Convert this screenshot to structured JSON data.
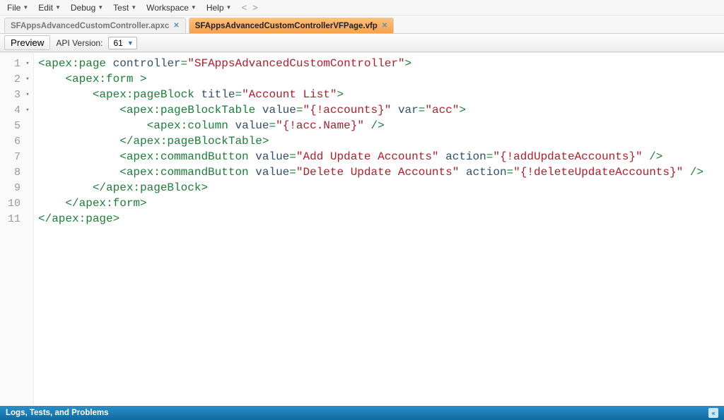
{
  "menu": {
    "items": [
      "File",
      "Edit",
      "Debug",
      "Test",
      "Workspace",
      "Help"
    ],
    "nav_back": "<",
    "nav_fwd": ">"
  },
  "tabs": [
    {
      "label": "SFAppsAdvancedCustomController.apxc",
      "active": false
    },
    {
      "label": "SFAppsAdvancedCustomControllerVFPage.vfp",
      "active": true
    }
  ],
  "subtoolbar": {
    "preview_label": "Preview",
    "api_label": "API Version:",
    "api_value": "61"
  },
  "code": {
    "lines": [
      {
        "num": 1,
        "fold": true,
        "indent": "",
        "tokens": [
          {
            "t": "pun",
            "v": "<"
          },
          {
            "t": "tag",
            "v": "apex:page"
          },
          {
            "t": "txt",
            "v": " "
          },
          {
            "t": "an",
            "v": "controller"
          },
          {
            "t": "pun",
            "v": "="
          },
          {
            "t": "str",
            "v": "\"SFAppsAdvancedCustomController\""
          },
          {
            "t": "pun",
            "v": ">"
          }
        ]
      },
      {
        "num": 2,
        "fold": true,
        "indent": "    ",
        "tokens": [
          {
            "t": "pun",
            "v": "<"
          },
          {
            "t": "tag",
            "v": "apex:form"
          },
          {
            "t": "txt",
            "v": " "
          },
          {
            "t": "pun",
            "v": ">"
          }
        ]
      },
      {
        "num": 3,
        "fold": true,
        "indent": "        ",
        "tokens": [
          {
            "t": "pun",
            "v": "<"
          },
          {
            "t": "tag",
            "v": "apex:pageBlock"
          },
          {
            "t": "txt",
            "v": " "
          },
          {
            "t": "an",
            "v": "title"
          },
          {
            "t": "pun",
            "v": "="
          },
          {
            "t": "str",
            "v": "\"Account List\""
          },
          {
            "t": "pun",
            "v": ">"
          }
        ]
      },
      {
        "num": 4,
        "fold": true,
        "indent": "            ",
        "tokens": [
          {
            "t": "pun",
            "v": "<"
          },
          {
            "t": "tag",
            "v": "apex:pageBlockTable"
          },
          {
            "t": "txt",
            "v": " "
          },
          {
            "t": "an",
            "v": "value"
          },
          {
            "t": "pun",
            "v": "="
          },
          {
            "t": "str",
            "v": "\"{!accounts}\""
          },
          {
            "t": "txt",
            "v": " "
          },
          {
            "t": "an",
            "v": "var"
          },
          {
            "t": "pun",
            "v": "="
          },
          {
            "t": "str",
            "v": "\"acc\""
          },
          {
            "t": "pun",
            "v": ">"
          }
        ]
      },
      {
        "num": 5,
        "fold": false,
        "indent": "                ",
        "tokens": [
          {
            "t": "pun",
            "v": "<"
          },
          {
            "t": "tag",
            "v": "apex:column"
          },
          {
            "t": "txt",
            "v": " "
          },
          {
            "t": "an",
            "v": "value"
          },
          {
            "t": "pun",
            "v": "="
          },
          {
            "t": "str",
            "v": "\"{!acc.Name}\""
          },
          {
            "t": "txt",
            "v": " "
          },
          {
            "t": "pun",
            "v": "/>"
          }
        ]
      },
      {
        "num": 6,
        "fold": false,
        "indent": "            ",
        "tokens": [
          {
            "t": "pun",
            "v": "</"
          },
          {
            "t": "tag",
            "v": "apex:pageBlockTable"
          },
          {
            "t": "pun",
            "v": ">"
          }
        ]
      },
      {
        "num": 7,
        "fold": false,
        "indent": "            ",
        "tokens": [
          {
            "t": "pun",
            "v": "<"
          },
          {
            "t": "tag",
            "v": "apex:commandButton"
          },
          {
            "t": "txt",
            "v": " "
          },
          {
            "t": "an",
            "v": "value"
          },
          {
            "t": "pun",
            "v": "="
          },
          {
            "t": "str",
            "v": "\"Add Update Accounts\""
          },
          {
            "t": "txt",
            "v": " "
          },
          {
            "t": "an",
            "v": "action"
          },
          {
            "t": "pun",
            "v": "="
          },
          {
            "t": "str",
            "v": "\"{!addUpdateAccounts}\""
          },
          {
            "t": "txt",
            "v": " "
          },
          {
            "t": "pun",
            "v": "/>"
          }
        ]
      },
      {
        "num": 8,
        "fold": false,
        "indent": "            ",
        "tokens": [
          {
            "t": "pun",
            "v": "<"
          },
          {
            "t": "tag",
            "v": "apex:commandButton"
          },
          {
            "t": "txt",
            "v": " "
          },
          {
            "t": "an",
            "v": "value"
          },
          {
            "t": "pun",
            "v": "="
          },
          {
            "t": "str",
            "v": "\"Delete Update Accounts\""
          },
          {
            "t": "txt",
            "v": " "
          },
          {
            "t": "an",
            "v": "action"
          },
          {
            "t": "pun",
            "v": "="
          },
          {
            "t": "str",
            "v": "\"{!deleteUpdateAccounts}\""
          },
          {
            "t": "txt",
            "v": " "
          },
          {
            "t": "pun",
            "v": "/>"
          }
        ]
      },
      {
        "num": 9,
        "fold": false,
        "indent": "        ",
        "tokens": [
          {
            "t": "pun",
            "v": "</"
          },
          {
            "t": "tag",
            "v": "apex:pageBlock"
          },
          {
            "t": "pun",
            "v": ">"
          }
        ]
      },
      {
        "num": 10,
        "fold": false,
        "indent": "    ",
        "tokens": [
          {
            "t": "pun",
            "v": "</"
          },
          {
            "t": "tag",
            "v": "apex:form"
          },
          {
            "t": "pun",
            "v": ">"
          }
        ]
      },
      {
        "num": 11,
        "fold": false,
        "indent": "",
        "tokens": [
          {
            "t": "pun",
            "v": "</"
          },
          {
            "t": "tag",
            "v": "apex:page"
          },
          {
            "t": "pun",
            "v": ">"
          }
        ]
      }
    ]
  },
  "bottom_panel": {
    "title": "Logs, Tests, and Problems"
  }
}
